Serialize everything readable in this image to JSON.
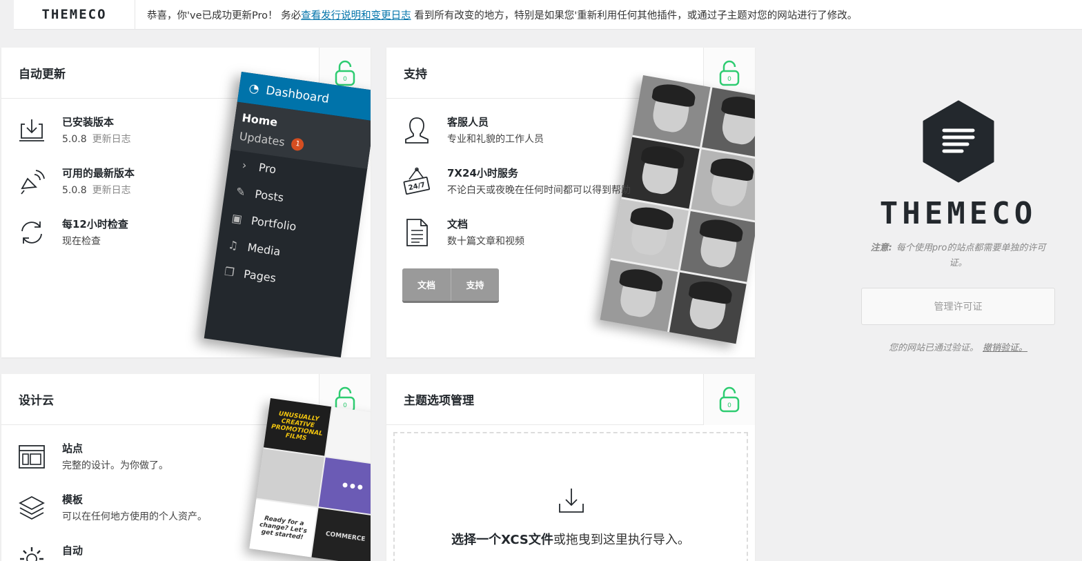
{
  "notice": {
    "brand": "THEMECO",
    "message_pre": "恭喜，你've已成功更新Pro！ 务必",
    "message_link": "查看发行说明和变更日志",
    "message_post": " 看到所有改变的地方，特别是如果您'重新利用任何其他插件，或通过子主题对您的网站进行了修改。"
  },
  "auto_update": {
    "title": "自动更新",
    "rows": [
      {
        "title": "已安装版本",
        "value": "5.0.8",
        "link": "更新日志"
      },
      {
        "title": "可用的最新版本",
        "value": "5.0.8",
        "link": "更新日志"
      },
      {
        "title": "每12小时检查",
        "value": "现在检查"
      }
    ],
    "menu": {
      "dashboard": "Dashboard",
      "home": "Home",
      "updates": "Updates",
      "updates_count": "1",
      "items": [
        "Pro",
        "Posts",
        "Portfolio",
        "Media",
        "Pages"
      ]
    }
  },
  "support": {
    "title": "支持",
    "rows": [
      {
        "title": "客服人员",
        "desc": "专业和礼貌的工作人员"
      },
      {
        "title": "7X24小时服务",
        "desc": "不论白天或夜晚在任何时间都可以得到帮助"
      },
      {
        "title": "文档",
        "desc": "数十篇文章和视频"
      }
    ],
    "buttons": [
      "文档",
      "支持"
    ],
    "sign_text": "24/7"
  },
  "design_cloud": {
    "title": "设计云",
    "rows": [
      {
        "title": "站点",
        "desc": "完整的设计。为你做了。"
      },
      {
        "title": "模板",
        "desc": "可以在任何地方使用的个人资产。"
      },
      {
        "title": "自动",
        "desc": ""
      }
    ],
    "tiles": [
      "UNUSUALLY CREATIVE PROMOTIONAL FILMS",
      "",
      "Ready for a change? Let's get started!",
      "COMMERCE"
    ]
  },
  "theme_options": {
    "title": "主题选项管理",
    "drop_bold": "选择一个XCS文件",
    "drop_rest": "或拖曳到这里执行导入。"
  },
  "sidebar": {
    "brand": "THEMECO",
    "note_label": "注意:",
    "note_text": "每个使用pro的站点都需要单独的许可证。",
    "manage_button": "管理许可证",
    "verified_text": "您的网站已通过验证。",
    "revoke_link": "撤销验证。"
  },
  "colors": {
    "lock_green": "#2ecc71",
    "link_blue": "#0073aa",
    "wp_blue": "#0073aa",
    "wp_dark": "#23282d"
  }
}
